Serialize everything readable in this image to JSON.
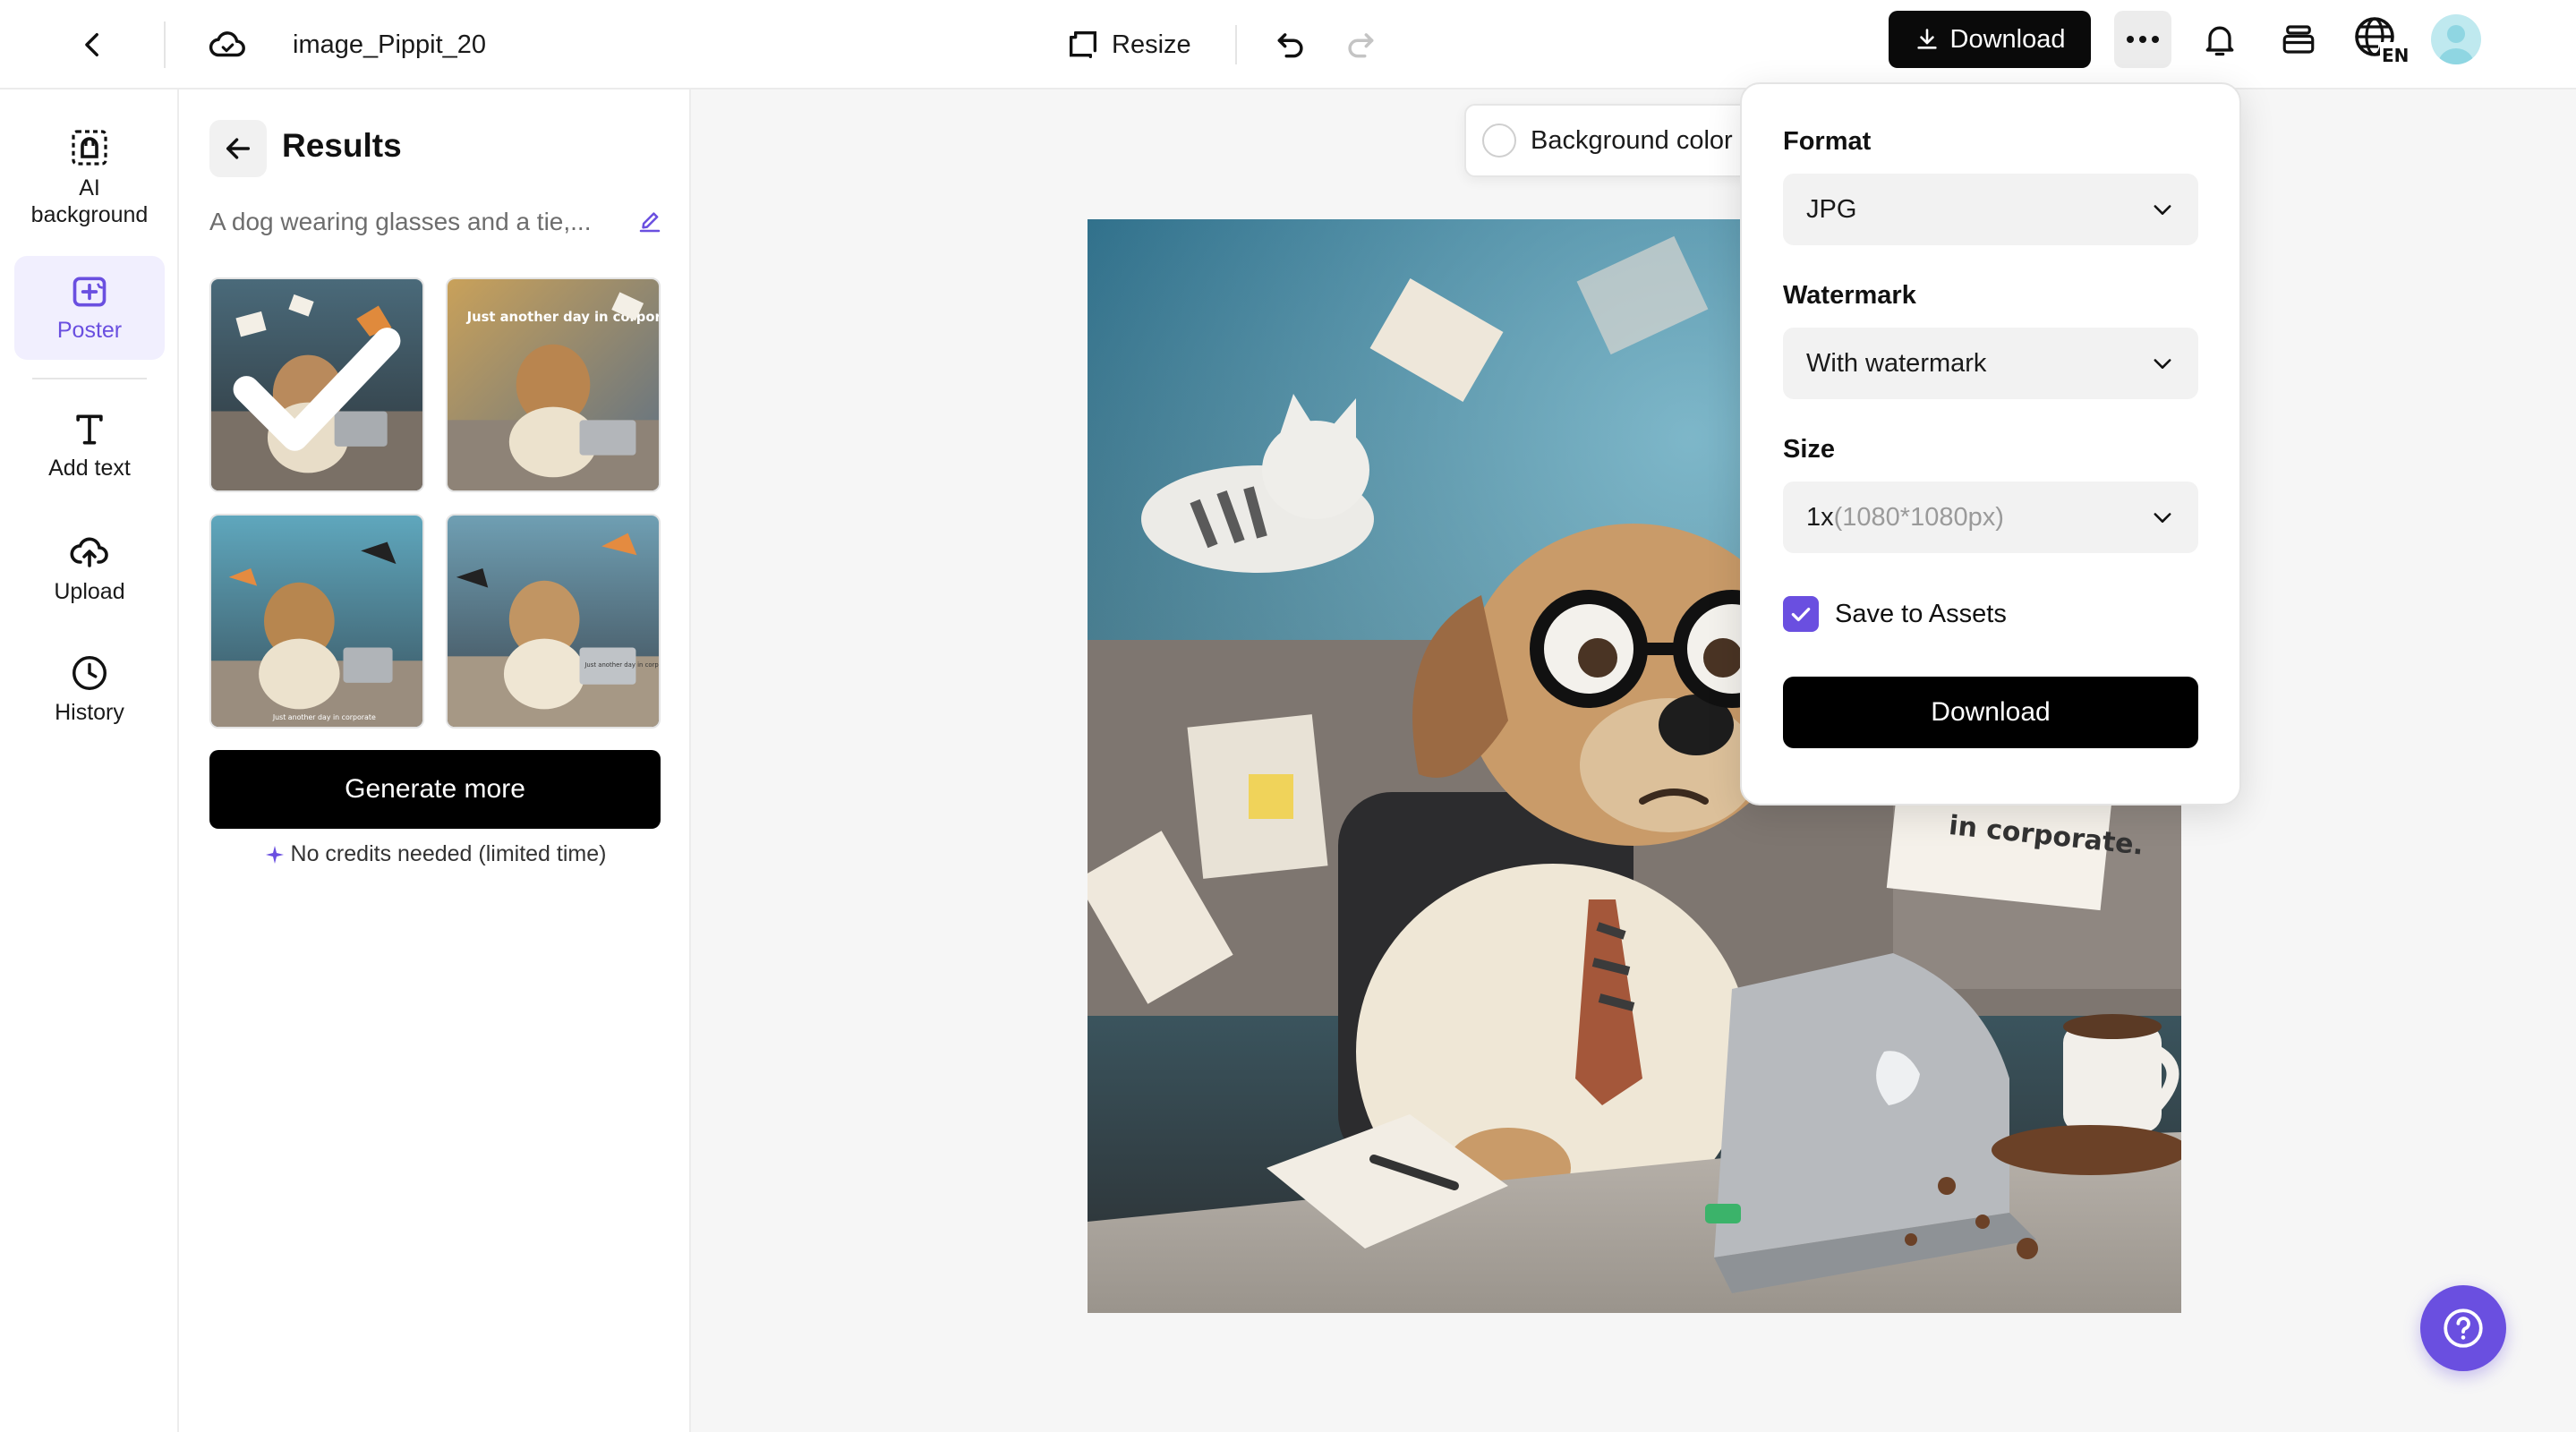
{
  "header": {
    "doc_title": "image_Pippit_20",
    "resize_label": "Resize",
    "download_label": "Download"
  },
  "sidebar": {
    "items": [
      {
        "label": "AI background",
        "icon": "ai-background-icon"
      },
      {
        "label": "Poster",
        "icon": "poster-icon",
        "active": true
      },
      {
        "label": "Add text",
        "icon": "text-icon"
      },
      {
        "label": "Upload",
        "icon": "upload-cloud-icon"
      },
      {
        "label": "History",
        "icon": "clock-icon"
      }
    ]
  },
  "results": {
    "title": "Results",
    "prompt": "A dog wearing glasses and a tie,...",
    "thumb_captions": [
      "Just another day in corporate",
      "Just another day in corporate",
      "Just another day in corporate"
    ],
    "generate_label": "Generate more",
    "credits_note": "No credits needed (limited time)"
  },
  "canvas": {
    "bg_color_label": "Background color",
    "sign_text": "in corporate."
  },
  "download_panel": {
    "format_label": "Format",
    "format_value": "JPG",
    "watermark_label": "Watermark",
    "watermark_value": "With watermark",
    "size_label": "Size",
    "size_value_main": "1x",
    "size_value_detail": "(1080*1080px)",
    "save_label": "Save to Assets",
    "save_checked": true,
    "download_label": "Download"
  },
  "colors": {
    "accent": "#6a4fe0",
    "primary_button": "#000000",
    "active_item_bg": "#f1effe"
  }
}
